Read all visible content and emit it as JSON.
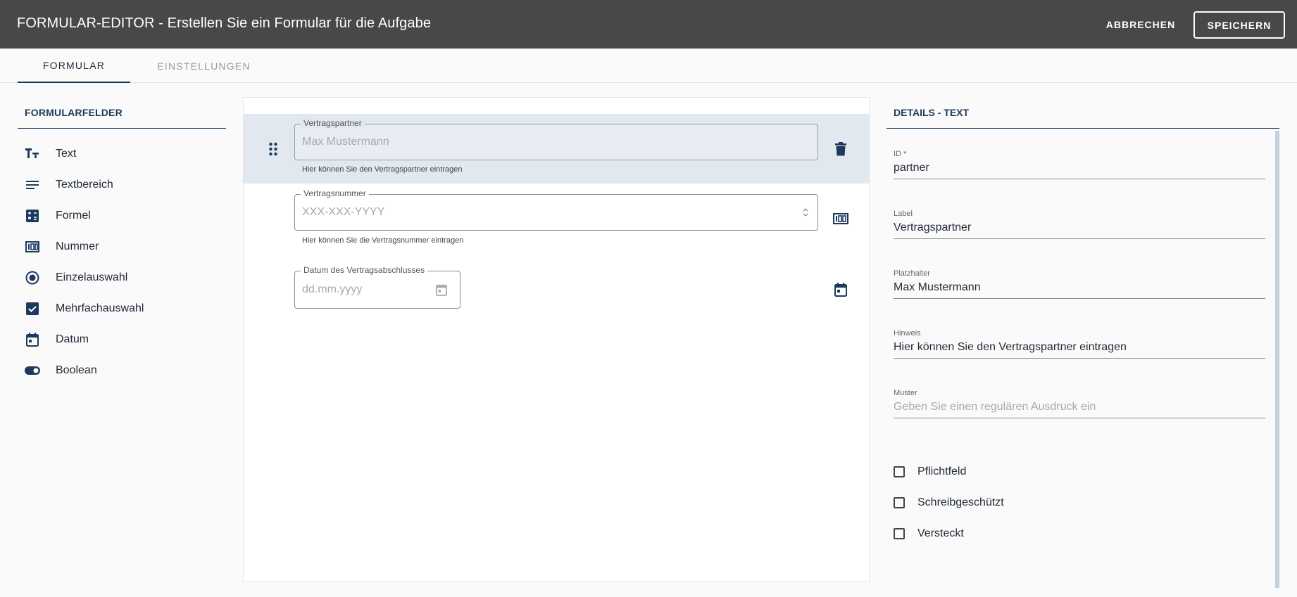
{
  "header": {
    "title": "FORMULAR-EDITOR - Erstellen Sie ein Formular für die Aufgabe",
    "cancel_label": "ABBRECHEN",
    "save_label": "SPEICHERN"
  },
  "tabs": [
    {
      "label": "FORMULAR",
      "active": true
    },
    {
      "label": "EINSTELLUNGEN",
      "active": false
    }
  ],
  "sidebar": {
    "title": "FORMULARFELDER",
    "items": [
      {
        "label": "Text",
        "icon": "text-format-icon"
      },
      {
        "label": "Textbereich",
        "icon": "text-lines-icon"
      },
      {
        "label": "Formel",
        "icon": "calculator-icon"
      },
      {
        "label": "Nummer",
        "icon": "number-icon"
      },
      {
        "label": "Einzelauswahl",
        "icon": "radio-icon"
      },
      {
        "label": "Mehrfachauswahl",
        "icon": "checkbox-icon"
      },
      {
        "label": "Datum",
        "icon": "calendar-icon"
      },
      {
        "label": "Boolean",
        "icon": "toggle-icon"
      }
    ]
  },
  "form": {
    "fields": [
      {
        "label": "Vertragspartner",
        "placeholder": "Max Mustermann",
        "hint": "Hier können Sie den Vertragspartner eintragen",
        "icon": "trash-icon"
      },
      {
        "label": "Vertragsnummer",
        "placeholder": "XXX-XXX-YYYY",
        "hint": "Hier können Sie die Vertragsnummer eintragen",
        "icon": "number-icon"
      },
      {
        "label": "Datum des Vertragsabschlusses",
        "placeholder": "dd.mm.yyyy",
        "hint": "",
        "icon": "calendar-icon"
      }
    ]
  },
  "details": {
    "title": "DETAILS - TEXT",
    "fields": [
      {
        "label": "ID *",
        "value": "partner",
        "placeholder": ""
      },
      {
        "label": "Label",
        "value": "Vertragspartner",
        "placeholder": ""
      },
      {
        "label": "Platzhalter",
        "value": "Max Mustermann",
        "placeholder": ""
      },
      {
        "label": "Hinweis",
        "value": "Hier können Sie den Vertragspartner eintragen",
        "placeholder": ""
      },
      {
        "label": "Muster",
        "value": "",
        "placeholder": "Geben Sie einen regulären Ausdruck ein"
      }
    ],
    "checkboxes": [
      {
        "label": "Pflichtfeld",
        "checked": false
      },
      {
        "label": "Schreibgeschützt",
        "checked": false
      },
      {
        "label": "Versteckt",
        "checked": false
      }
    ]
  },
  "colors": {
    "header_bg": "#484848",
    "accent": "#1c3a5c",
    "selected_row": "#e1e8f0"
  }
}
